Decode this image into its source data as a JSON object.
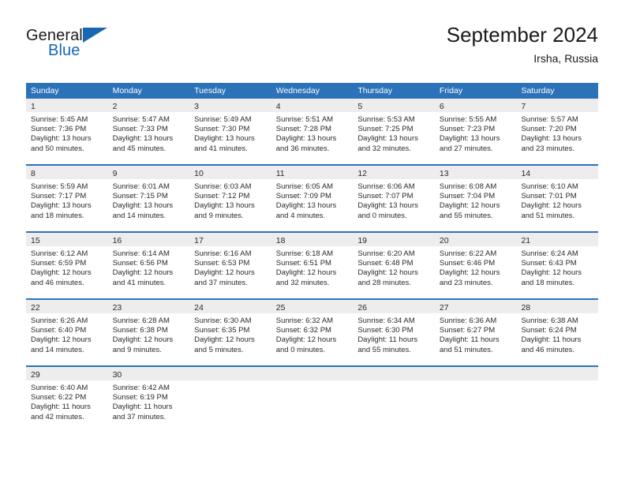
{
  "brand": {
    "name_part1": "General",
    "name_part2": "Blue",
    "accent_color": "#1767b2"
  },
  "header": {
    "title": "September 2024",
    "subtitle": "Irsha, Russia"
  },
  "theme": {
    "header_bar_color": "#2c72b8",
    "daynum_band_color": "#ededed",
    "text_color": "#2a2a2a"
  },
  "calendar": {
    "weekday_headers": [
      "Sunday",
      "Monday",
      "Tuesday",
      "Wednesday",
      "Thursday",
      "Friday",
      "Saturday"
    ],
    "weeks": [
      [
        {
          "day": "1",
          "sunrise": "Sunrise: 5:45 AM",
          "sunset": "Sunset: 7:36 PM",
          "daylight1": "Daylight: 13 hours",
          "daylight2": "and 50 minutes."
        },
        {
          "day": "2",
          "sunrise": "Sunrise: 5:47 AM",
          "sunset": "Sunset: 7:33 PM",
          "daylight1": "Daylight: 13 hours",
          "daylight2": "and 45 minutes."
        },
        {
          "day": "3",
          "sunrise": "Sunrise: 5:49 AM",
          "sunset": "Sunset: 7:30 PM",
          "daylight1": "Daylight: 13 hours",
          "daylight2": "and 41 minutes."
        },
        {
          "day": "4",
          "sunrise": "Sunrise: 5:51 AM",
          "sunset": "Sunset: 7:28 PM",
          "daylight1": "Daylight: 13 hours",
          "daylight2": "and 36 minutes."
        },
        {
          "day": "5",
          "sunrise": "Sunrise: 5:53 AM",
          "sunset": "Sunset: 7:25 PM",
          "daylight1": "Daylight: 13 hours",
          "daylight2": "and 32 minutes."
        },
        {
          "day": "6",
          "sunrise": "Sunrise: 5:55 AM",
          "sunset": "Sunset: 7:23 PM",
          "daylight1": "Daylight: 13 hours",
          "daylight2": "and 27 minutes."
        },
        {
          "day": "7",
          "sunrise": "Sunrise: 5:57 AM",
          "sunset": "Sunset: 7:20 PM",
          "daylight1": "Daylight: 13 hours",
          "daylight2": "and 23 minutes."
        }
      ],
      [
        {
          "day": "8",
          "sunrise": "Sunrise: 5:59 AM",
          "sunset": "Sunset: 7:17 PM",
          "daylight1": "Daylight: 13 hours",
          "daylight2": "and 18 minutes."
        },
        {
          "day": "9",
          "sunrise": "Sunrise: 6:01 AM",
          "sunset": "Sunset: 7:15 PM",
          "daylight1": "Daylight: 13 hours",
          "daylight2": "and 14 minutes."
        },
        {
          "day": "10",
          "sunrise": "Sunrise: 6:03 AM",
          "sunset": "Sunset: 7:12 PM",
          "daylight1": "Daylight: 13 hours",
          "daylight2": "and 9 minutes."
        },
        {
          "day": "11",
          "sunrise": "Sunrise: 6:05 AM",
          "sunset": "Sunset: 7:09 PM",
          "daylight1": "Daylight: 13 hours",
          "daylight2": "and 4 minutes."
        },
        {
          "day": "12",
          "sunrise": "Sunrise: 6:06 AM",
          "sunset": "Sunset: 7:07 PM",
          "daylight1": "Daylight: 13 hours",
          "daylight2": "and 0 minutes."
        },
        {
          "day": "13",
          "sunrise": "Sunrise: 6:08 AM",
          "sunset": "Sunset: 7:04 PM",
          "daylight1": "Daylight: 12 hours",
          "daylight2": "and 55 minutes."
        },
        {
          "day": "14",
          "sunrise": "Sunrise: 6:10 AM",
          "sunset": "Sunset: 7:01 PM",
          "daylight1": "Daylight: 12 hours",
          "daylight2": "and 51 minutes."
        }
      ],
      [
        {
          "day": "15",
          "sunrise": "Sunrise: 6:12 AM",
          "sunset": "Sunset: 6:59 PM",
          "daylight1": "Daylight: 12 hours",
          "daylight2": "and 46 minutes."
        },
        {
          "day": "16",
          "sunrise": "Sunrise: 6:14 AM",
          "sunset": "Sunset: 6:56 PM",
          "daylight1": "Daylight: 12 hours",
          "daylight2": "and 41 minutes."
        },
        {
          "day": "17",
          "sunrise": "Sunrise: 6:16 AM",
          "sunset": "Sunset: 6:53 PM",
          "daylight1": "Daylight: 12 hours",
          "daylight2": "and 37 minutes."
        },
        {
          "day": "18",
          "sunrise": "Sunrise: 6:18 AM",
          "sunset": "Sunset: 6:51 PM",
          "daylight1": "Daylight: 12 hours",
          "daylight2": "and 32 minutes."
        },
        {
          "day": "19",
          "sunrise": "Sunrise: 6:20 AM",
          "sunset": "Sunset: 6:48 PM",
          "daylight1": "Daylight: 12 hours",
          "daylight2": "and 28 minutes."
        },
        {
          "day": "20",
          "sunrise": "Sunrise: 6:22 AM",
          "sunset": "Sunset: 6:46 PM",
          "daylight1": "Daylight: 12 hours",
          "daylight2": "and 23 minutes."
        },
        {
          "day": "21",
          "sunrise": "Sunrise: 6:24 AM",
          "sunset": "Sunset: 6:43 PM",
          "daylight1": "Daylight: 12 hours",
          "daylight2": "and 18 minutes."
        }
      ],
      [
        {
          "day": "22",
          "sunrise": "Sunrise: 6:26 AM",
          "sunset": "Sunset: 6:40 PM",
          "daylight1": "Daylight: 12 hours",
          "daylight2": "and 14 minutes."
        },
        {
          "day": "23",
          "sunrise": "Sunrise: 6:28 AM",
          "sunset": "Sunset: 6:38 PM",
          "daylight1": "Daylight: 12 hours",
          "daylight2": "and 9 minutes."
        },
        {
          "day": "24",
          "sunrise": "Sunrise: 6:30 AM",
          "sunset": "Sunset: 6:35 PM",
          "daylight1": "Daylight: 12 hours",
          "daylight2": "and 5 minutes."
        },
        {
          "day": "25",
          "sunrise": "Sunrise: 6:32 AM",
          "sunset": "Sunset: 6:32 PM",
          "daylight1": "Daylight: 12 hours",
          "daylight2": "and 0 minutes."
        },
        {
          "day": "26",
          "sunrise": "Sunrise: 6:34 AM",
          "sunset": "Sunset: 6:30 PM",
          "daylight1": "Daylight: 11 hours",
          "daylight2": "and 55 minutes."
        },
        {
          "day": "27",
          "sunrise": "Sunrise: 6:36 AM",
          "sunset": "Sunset: 6:27 PM",
          "daylight1": "Daylight: 11 hours",
          "daylight2": "and 51 minutes."
        },
        {
          "day": "28",
          "sunrise": "Sunrise: 6:38 AM",
          "sunset": "Sunset: 6:24 PM",
          "daylight1": "Daylight: 11 hours",
          "daylight2": "and 46 minutes."
        }
      ],
      [
        {
          "day": "29",
          "sunrise": "Sunrise: 6:40 AM",
          "sunset": "Sunset: 6:22 PM",
          "daylight1": "Daylight: 11 hours",
          "daylight2": "and 42 minutes."
        },
        {
          "day": "30",
          "sunrise": "Sunrise: 6:42 AM",
          "sunset": "Sunset: 6:19 PM",
          "daylight1": "Daylight: 11 hours",
          "daylight2": "and 37 minutes."
        },
        {
          "day": "",
          "sunrise": "",
          "sunset": "",
          "daylight1": "",
          "daylight2": ""
        },
        {
          "day": "",
          "sunrise": "",
          "sunset": "",
          "daylight1": "",
          "daylight2": ""
        },
        {
          "day": "",
          "sunrise": "",
          "sunset": "",
          "daylight1": "",
          "daylight2": ""
        },
        {
          "day": "",
          "sunrise": "",
          "sunset": "",
          "daylight1": "",
          "daylight2": ""
        },
        {
          "day": "",
          "sunrise": "",
          "sunset": "",
          "daylight1": "",
          "daylight2": ""
        }
      ]
    ]
  }
}
